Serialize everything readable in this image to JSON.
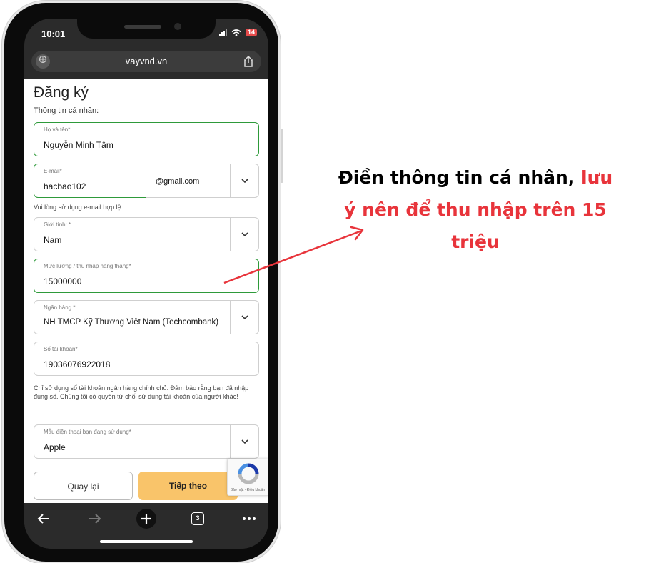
{
  "status_bar": {
    "time": "10:01",
    "battery": "14"
  },
  "browser": {
    "url": "vayvnd.vn",
    "tab_count": "3"
  },
  "form": {
    "title": "Đăng ký",
    "section_label": "Thông tin cá nhân:",
    "full_name": {
      "label": "Họ và tên*",
      "value": "Nguyễn Minh Tâm"
    },
    "email": {
      "label": "E-mail*",
      "value": "hacbao102",
      "domain": "@gmail.com",
      "hint": "Vui lòng sử dụng e-mail hợp lệ"
    },
    "gender": {
      "label": "Giới tính: *",
      "value": "Nam"
    },
    "income": {
      "label": "Mức lương / thu nhập hàng tháng*",
      "value": "15000000"
    },
    "bank": {
      "label": "Ngân hàng *",
      "value": "NH TMCP Kỹ Thương Việt Nam (Techcombank)"
    },
    "account_number": {
      "label": "Số tài khoản*",
      "value": "19036076922018"
    },
    "account_hint": "Chỉ sử dụng số tài khoản ngân hàng chính chủ. Đảm bảo rằng bạn đã nhập đúng số. Chúng tôi có quyền từ chối sử dụng tài khoản của người khác!",
    "phone_model": {
      "label": "Mẫu điện thoại bạn đang sử dụng*",
      "value": "Apple"
    },
    "back_button": "Quay lại",
    "next_button": "Tiếp theo",
    "recaptcha_text": "Bảo mật - Điều khoản"
  },
  "annotation": {
    "text_black": "Điền thông tin cá nhân,",
    "text_red_1": "lưu",
    "text_red_2": "ý nên để thu nhập trên 15",
    "text_red_3": "triệu"
  },
  "colors": {
    "accent_green": "#2e9a3a",
    "next_button": "#f9c46a",
    "annotation_red": "#e8343b"
  }
}
